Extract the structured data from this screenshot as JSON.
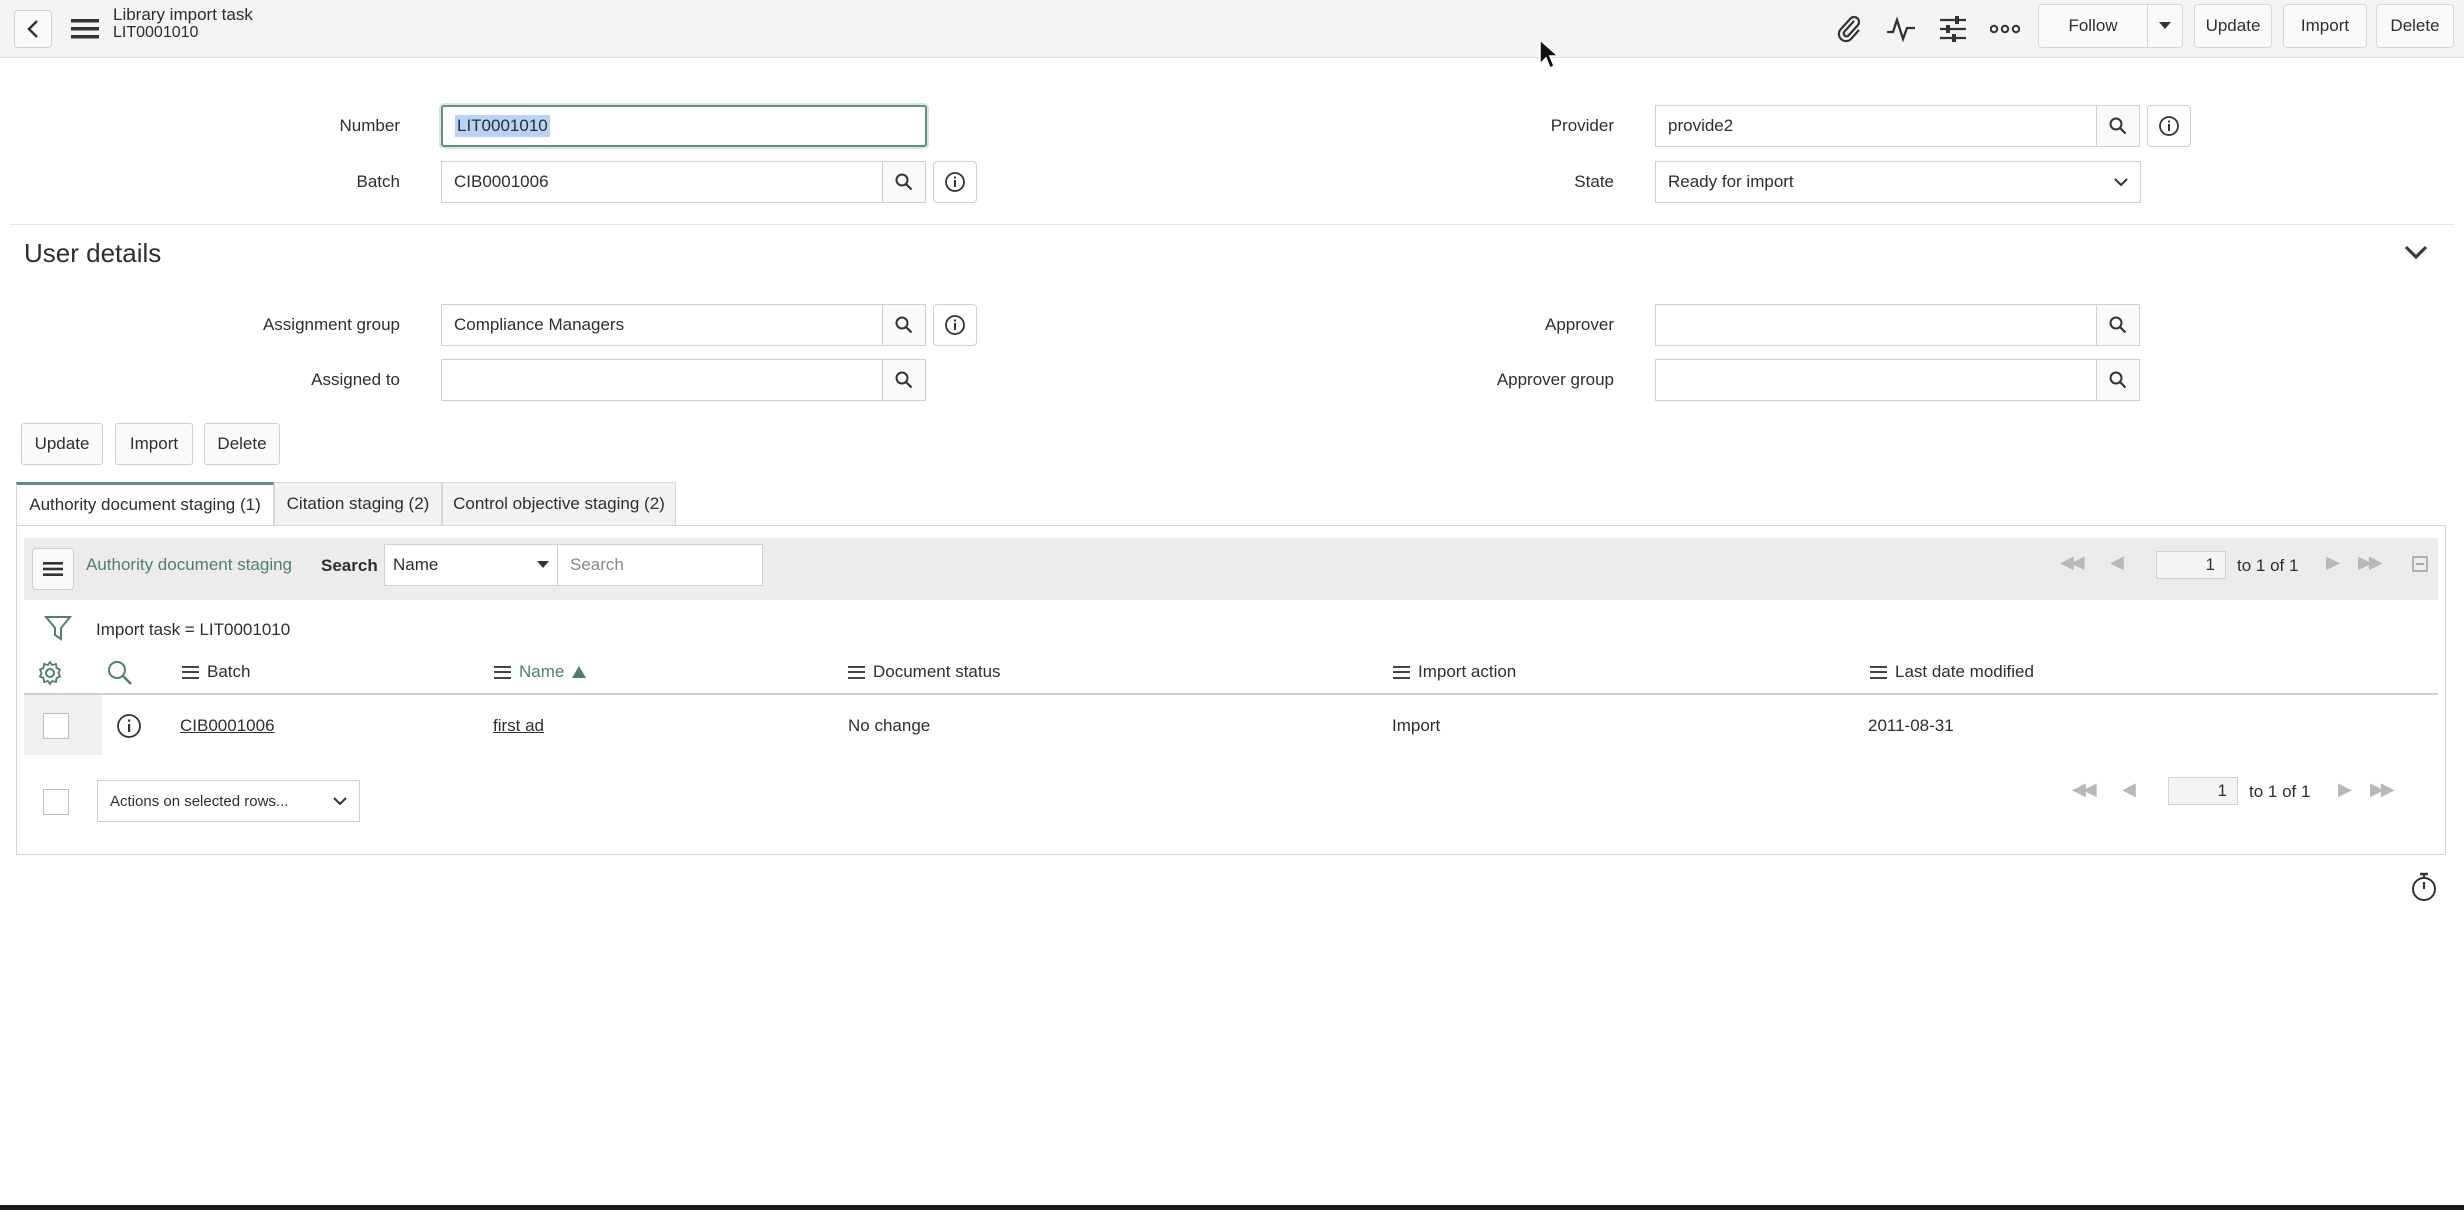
{
  "header": {
    "title": "Library import task",
    "subtitle": "LIT0001010",
    "follow_label": "Follow",
    "update_label": "Update",
    "import_label": "Import",
    "delete_label": "Delete"
  },
  "form": {
    "number_label": "Number",
    "number_value": "LIT0001010",
    "batch_label": "Batch",
    "batch_value": "CIB0001006",
    "provider_label": "Provider",
    "provider_value": "provide2",
    "state_label": "State",
    "state_value": "Ready for import"
  },
  "user_details": {
    "title": "User details",
    "assignment_group_label": "Assignment group",
    "assignment_group_value": "Compliance Managers",
    "assigned_to_label": "Assigned to",
    "assigned_to_value": "",
    "approver_label": "Approver",
    "approver_value": "",
    "approver_group_label": "Approver group",
    "approver_group_value": ""
  },
  "form_buttons": {
    "update": "Update",
    "import": "Import",
    "delete": "Delete"
  },
  "tabs": [
    {
      "label": "Authority document staging (1)",
      "active": true
    },
    {
      "label": "Citation staging (2)",
      "active": false
    },
    {
      "label": "Control objective staging (2)",
      "active": false
    }
  ],
  "list": {
    "title": "Authority document staging",
    "search_label": "Search",
    "search_field": "Name",
    "search_placeholder": "Search",
    "page_value": "1",
    "page_of": "to 1 of 1",
    "filter_text": "Import task = LIT0001010",
    "columns": [
      "Batch",
      "Name",
      "Document status",
      "Import action",
      "Last date modified"
    ],
    "rows": [
      {
        "batch": "CIB0001006",
        "name": "first ad",
        "document_status": "No change",
        "import_action": "Import",
        "last_modified": "2011-08-31"
      }
    ],
    "actions_label": "Actions on selected rows...",
    "bottom_page_value": "1",
    "bottom_page_of": "to 1 of 1"
  },
  "colors": {
    "accent": "#5f8f7f",
    "header_bg": "#f4f4f4"
  }
}
